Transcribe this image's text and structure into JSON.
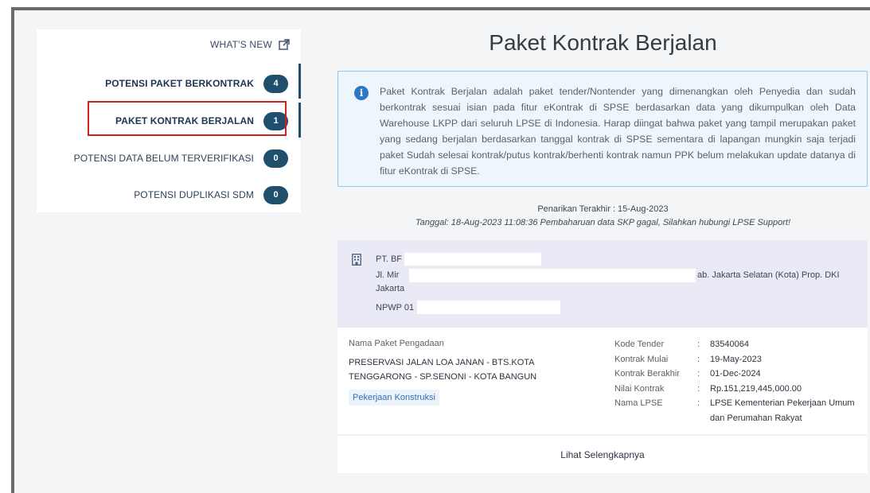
{
  "sidebar": {
    "whats_new": "WHAT'S NEW",
    "items": [
      {
        "label": "POTENSI PAKET BERKONTRAK",
        "count": "4"
      },
      {
        "label": "PAKET KONTRAK BERJALAN",
        "count": "1"
      },
      {
        "label": "POTENSI DATA BELUM TERVERIFIKASI",
        "count": "0"
      },
      {
        "label": "POTENSI DUPLIKASI SDM",
        "count": "0"
      }
    ]
  },
  "main": {
    "title": "Paket Kontrak Berjalan",
    "info": "Paket Kontrak Berjalan adalah paket tender/Nontender yang dimenangkan oleh Penyedia dan sudah berkontrak sesuai isian pada fitur eKontrak di SPSE berdasarkan data yang dikumpulkan oleh Data Warehouse LKPP dari seluruh LPSE di Indonesia. Harap diingat bahwa paket yang tampil merupakan paket yang sedang berjalan berdasarkan tanggal kontrak di SPSE sementara di lapangan mungkin saja terjadi paket Sudah selesai kontrak/putus kontrak/berhenti kontrak namun PPK belum melakukan update datanya di fitur eKontrak di SPSE.",
    "penarikan": "Penarikan Terakhir : 15-Aug-2023",
    "tanggal": "Tanggal: 18-Aug-2023 11:08:36 Pembaharuan data SKP gagal, Silahkan hubungi LPSE Support!"
  },
  "vendor": {
    "name": "PT. BF",
    "address_start": "Jl. Mir",
    "address_end": "ab. Jakarta Selatan (Kota) Prop. DKI",
    "address_line2": "Jakarta",
    "npwp": "NPWP 01"
  },
  "package": {
    "label": "Nama Paket Pengadaan",
    "name": "PRESERVASI JALAN LOA JANAN - BTS.KOTA TENGGARONG - SP.SENONI - KOTA BANGUN",
    "category": "Pekerjaan Konstruksi",
    "fields": [
      {
        "key": "Kode Tender",
        "value": "83540064"
      },
      {
        "key": "Kontrak Mulai",
        "value": "19-May-2023"
      },
      {
        "key": "Kontrak Berakhir",
        "value": "01-Dec-2024"
      },
      {
        "key": "Nilai Kontrak",
        "value": "Rp.151,219,445,000.00"
      },
      {
        "key": "Nama LPSE",
        "value": "LPSE Kementerian Pekerjaan Umum dan Perumahan Rakyat"
      }
    ],
    "separator": ":",
    "more_link": "Lihat Selengkapnya"
  }
}
